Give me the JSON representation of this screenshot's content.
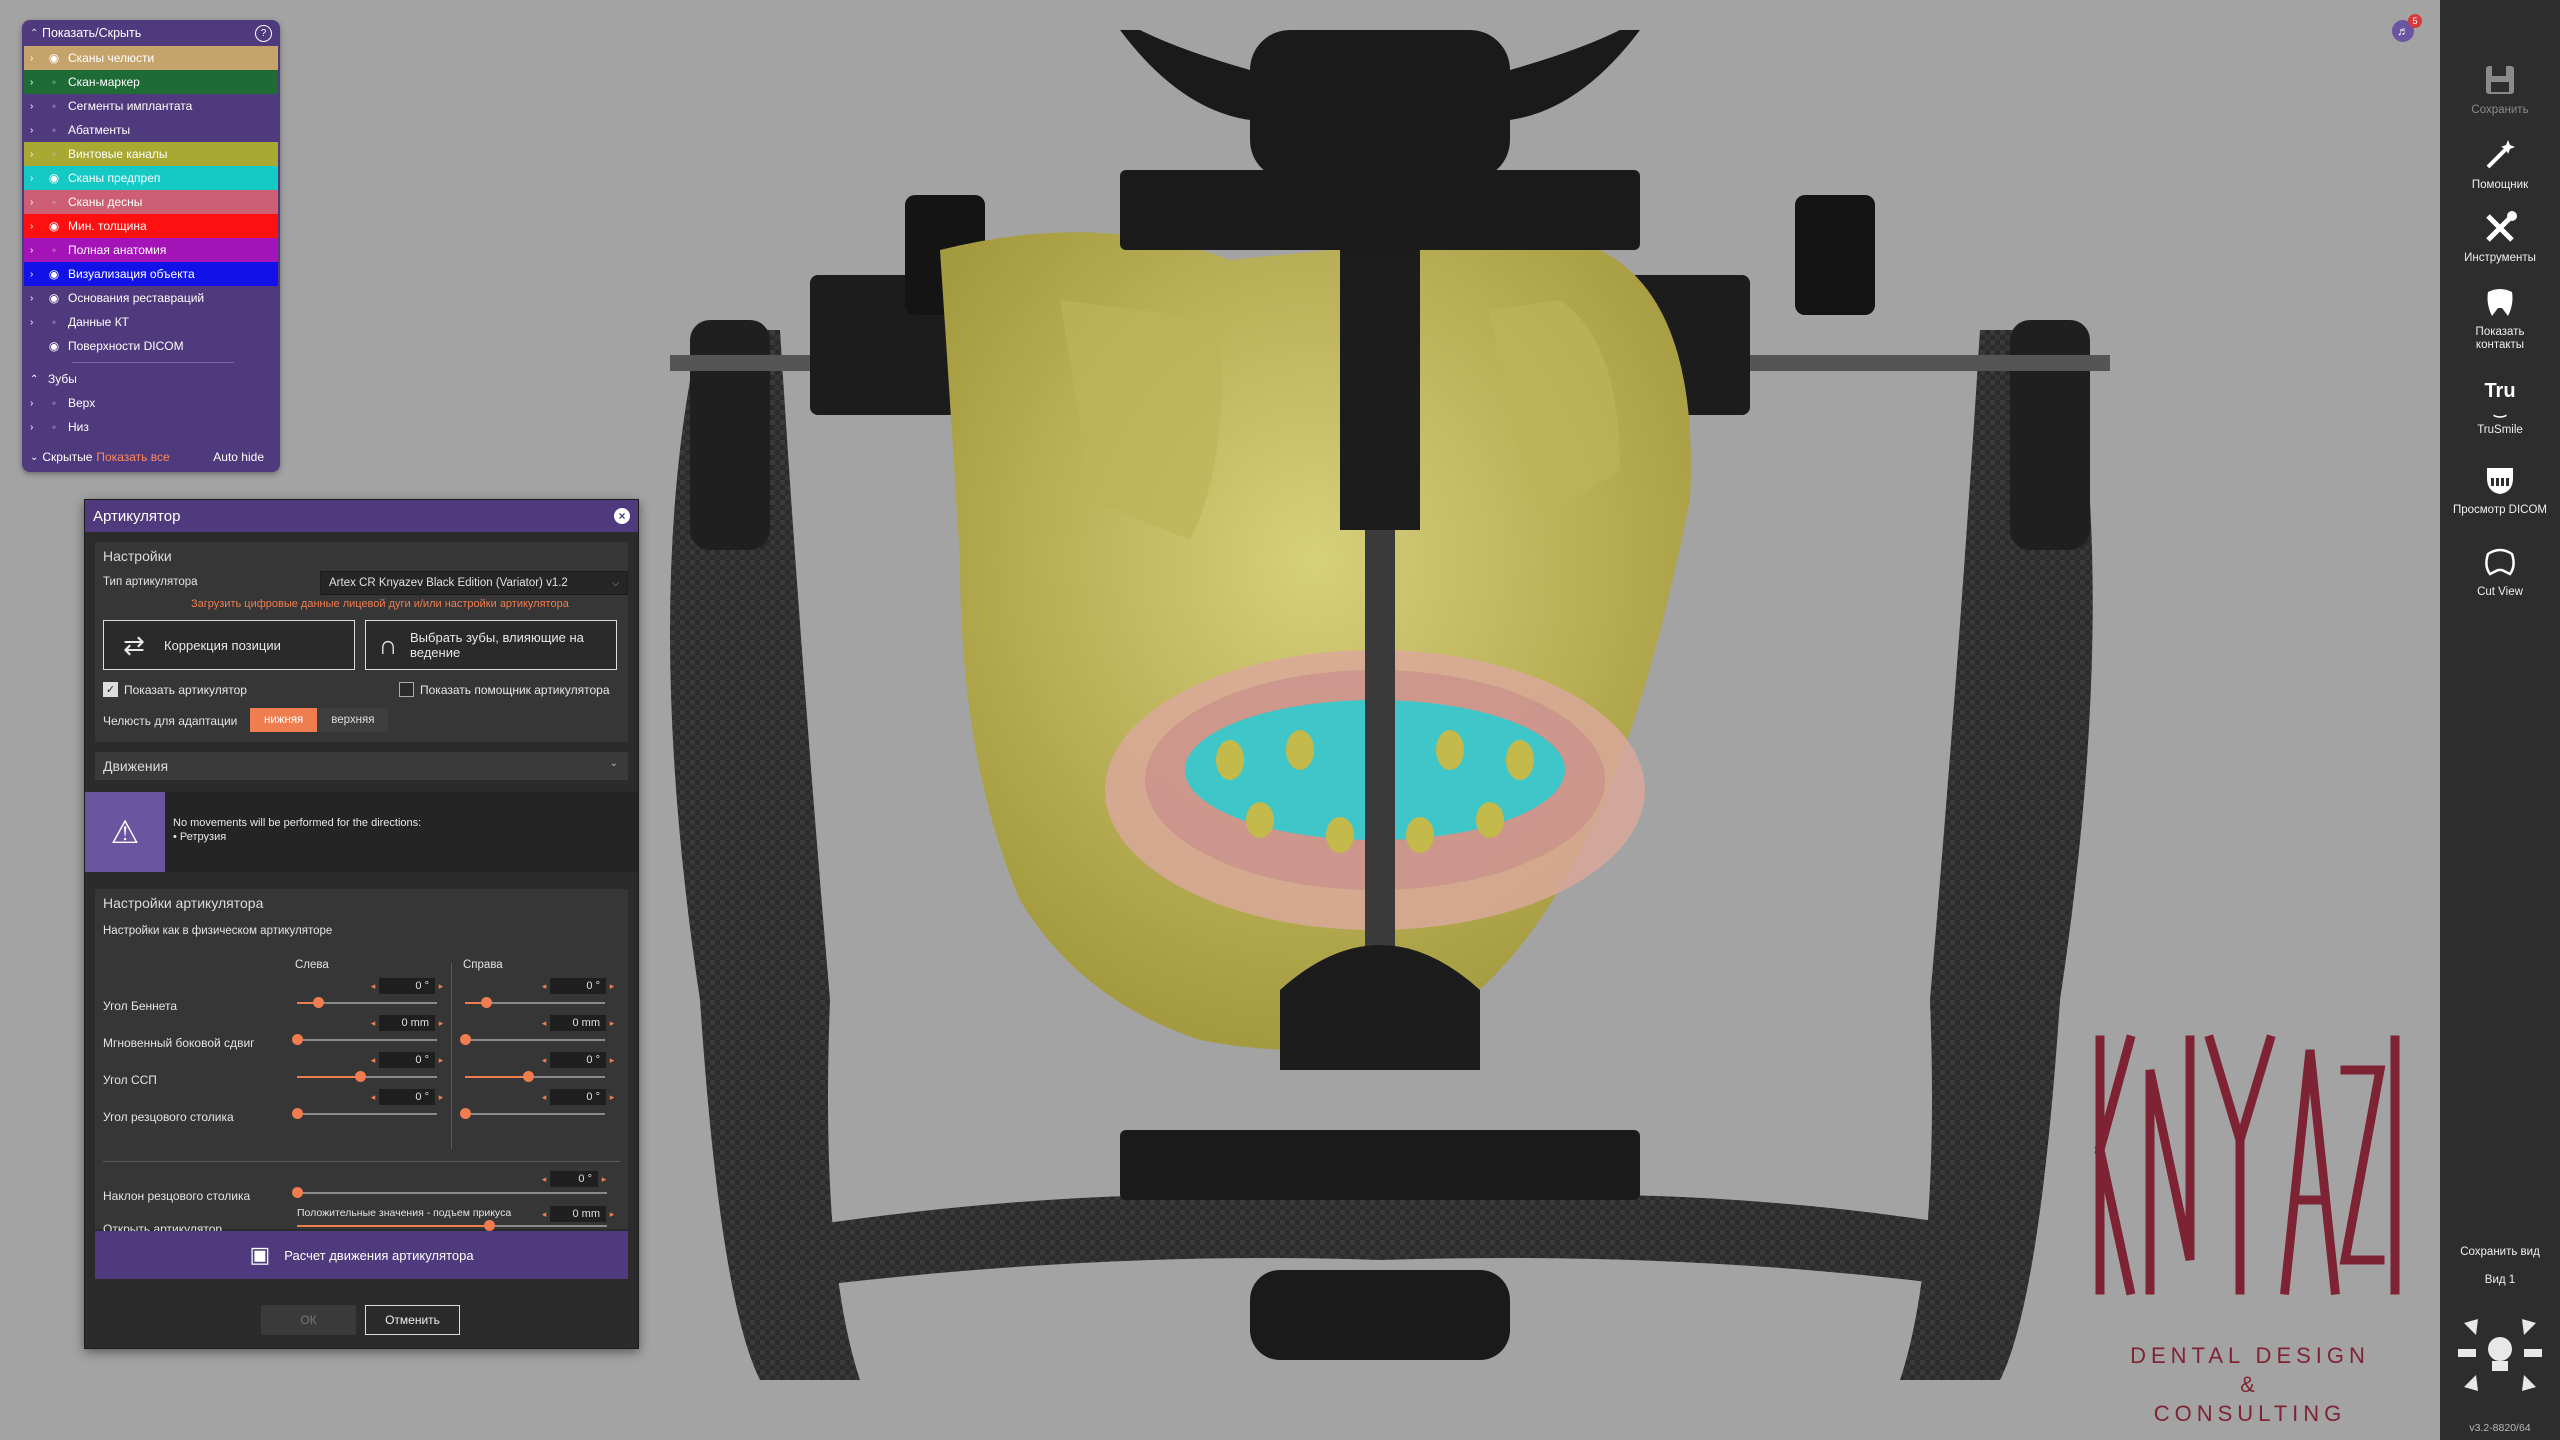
{
  "object_tree": {
    "header": "Показать/Скрыть",
    "items": [
      {
        "label": "Сканы челюсти",
        "color": "#c5a46c",
        "visible": true
      },
      {
        "label": "Скан-маркер",
        "color": "#1f6b36",
        "visible": false
      },
      {
        "label": "Сегменты имплантата",
        "color": "",
        "visible": false
      },
      {
        "label": "Абатменты",
        "color": "",
        "visible": false
      },
      {
        "label": "Винтовые каналы",
        "color": "#a8a832",
        "visible": false
      },
      {
        "label": "Сканы предпреп",
        "color": "#15c9c5",
        "visible": true
      },
      {
        "label": "Сканы десны",
        "color": "#cc5f74",
        "visible": false
      },
      {
        "label": "Мин. толщина",
        "color": "#ff1010",
        "visible": true
      },
      {
        "label": "Полная анатомия",
        "color": "#a413b8",
        "visible": false
      },
      {
        "label": "Визуализация объекта",
        "color": "#1212e8",
        "visible": true
      },
      {
        "label": "Основания реставраций",
        "color": "",
        "visible": true
      },
      {
        "label": "Данные КТ",
        "color": "",
        "visible": false
      },
      {
        "label": "Поверхности DICOM",
        "color": "",
        "visible": true
      }
    ],
    "teeth_header": "Зубы",
    "teeth": [
      {
        "label": "Верх"
      },
      {
        "label": "Низ"
      }
    ],
    "footer": {
      "hidden": "Скрытые",
      "show_all": "Показать все",
      "auto_hide": "Auto hide"
    }
  },
  "dialog": {
    "title": "Артикулятор",
    "settings": {
      "heading": "Настройки",
      "type_label": "Тип артикулятора",
      "type_value": "Artex CR Knyazev Black Edition (Variator) v1.2",
      "load_link": "Загрузить цифровые данные лицевой дуги и/или настройки артикулятора",
      "btn_correction": "Коррекция позиции",
      "btn_select_teeth": "Выбрать зубы, влияющие на ведение",
      "show_articulator": "Показать артикулятор",
      "show_articulator_checked": true,
      "show_helper": "Показать помощник артикулятора",
      "show_helper_checked": false,
      "jaw_label": "Челюсть для адаптации",
      "jaw_lower": "нижняя",
      "jaw_upper": "верхняя"
    },
    "movements": {
      "heading": "Движения",
      "warning_line1": "No movements will be performed for the directions:",
      "warning_line2": "• Ретрузия"
    },
    "art_settings": {
      "heading": "Настройки артикулятора",
      "sub": "Настройки как в физическом артикуляторе",
      "col_left": "Слева",
      "col_right": "Справа",
      "rows": [
        {
          "label": "Угол Беннета",
          "left": "0 °",
          "right": "0 °",
          "left_pos": 0.15,
          "right_pos": 0.15
        },
        {
          "label": "Мгновенный боковой сдвиг",
          "left": "0 mm",
          "right": "0 mm",
          "left_pos": 0.0,
          "right_pos": 0.0
        },
        {
          "label": "Угол ССП",
          "left": "0 °",
          "right": "0 °",
          "left_pos": 0.45,
          "right_pos": 0.45
        },
        {
          "label": "Угол резцового столика",
          "left": "0 °",
          "right": "0 °",
          "left_pos": 0.0,
          "right_pos": 0.0
        }
      ],
      "incline_label": "Наклон резцового столика",
      "incline_value": "0 °",
      "incline_pos": 0.0,
      "open_label": "Открыть артикулятор",
      "open_hint": "Положительные значения - подъем прикуса",
      "open_value": "0 mm",
      "open_pos": 0.62
    },
    "compute_btn": "Расчет движения артикулятора",
    "ok": "ОК",
    "cancel": "Отменить"
  },
  "toolbar": {
    "notification_count": "5",
    "items": [
      {
        "label": "Сохранить",
        "icon": "save-icon",
        "enabled": false
      },
      {
        "label": "Помощник",
        "icon": "magic-wand-icon",
        "enabled": true
      },
      {
        "label": "Инструменты",
        "icon": "tools-icon",
        "enabled": true
      },
      {
        "label": "Показать контакты",
        "icon": "tooth-contacts-icon",
        "enabled": true
      },
      {
        "label": "TruSmile",
        "icon": "trusmile-icon",
        "enabled": true
      },
      {
        "label": "Просмотр DICOM",
        "icon": "skull-icon",
        "enabled": true
      },
      {
        "label": "Cut View",
        "icon": "cut-view-icon",
        "enabled": true
      }
    ],
    "trusmile_glyph": "Tru",
    "save_view": "Сохранить вид",
    "view_name": "Вид 1",
    "version": "v3.2-8820/64"
  },
  "logo": {
    "wordmark": "KNYAZEV",
    "line1": "DENTAL DESIGN",
    "line2": "&",
    "line3": "CONSULTING",
    "color": "#7e2334"
  }
}
